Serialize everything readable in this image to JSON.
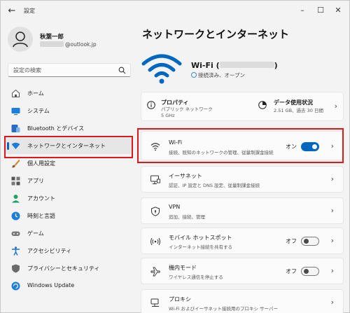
{
  "window": {
    "title": "設定"
  },
  "user": {
    "name": "秋葉一郎",
    "email_suffix": "@outlook.jp"
  },
  "search": {
    "placeholder": "設定の検索"
  },
  "sidebar": {
    "items": [
      {
        "label": "ホーム",
        "icon": "home-icon"
      },
      {
        "label": "システム",
        "icon": "system-icon"
      },
      {
        "label": "Bluetooth とデバイス",
        "icon": "bluetooth-icon"
      },
      {
        "label": "ネットワークとインターネット",
        "icon": "network-icon",
        "active": true
      },
      {
        "label": "個人用設定",
        "icon": "brush-icon"
      },
      {
        "label": "アプリ",
        "icon": "apps-icon"
      },
      {
        "label": "アカウント",
        "icon": "account-icon"
      },
      {
        "label": "時刻と言語",
        "icon": "time-language-icon"
      },
      {
        "label": "ゲーム",
        "icon": "gaming-icon"
      },
      {
        "label": "アクセシビリティ",
        "icon": "accessibility-icon"
      },
      {
        "label": "プライバシーとセキュリティ",
        "icon": "shield-icon"
      },
      {
        "label": "Windows Update",
        "icon": "update-icon"
      }
    ]
  },
  "main": {
    "heading": "ネットワークとインターネット",
    "wifi_header": {
      "name_prefix": "Wi-Fi (",
      "name_suffix": ")",
      "status": "接続済み、オープン"
    },
    "properties": {
      "title": "プロパティ",
      "sub1": "パブリック ネットワーク",
      "sub2": "5 GHz"
    },
    "data_usage": {
      "title": "データ使用状況",
      "sub": "2.51 GB、過去 30 日間"
    },
    "cards": [
      {
        "title": "Wi-Fi",
        "sub": "接続、既知のネットワークの管理、従量制課金接続",
        "state": "オン",
        "toggle": true,
        "icon": "wifi-icon"
      },
      {
        "title": "イーサネット",
        "sub": "認証、IP 設定と DNS 設定、従量制課金接続",
        "icon": "ethernet-icon"
      },
      {
        "title": "VPN",
        "sub": "追加、接続、管理",
        "icon": "vpn-shield-icon"
      },
      {
        "title": "モバイル ホットスポット",
        "sub": "インターネット接続を共有する",
        "state": "オフ",
        "toggle": false,
        "icon": "hotspot-icon"
      },
      {
        "title": "機内モード",
        "sub": "ワイヤレス通信を停止する",
        "state": "オフ",
        "toggle": false,
        "icon": "airplane-icon"
      },
      {
        "title": "プロキシ",
        "sub": "Wi-Fi およびイーサネット接続用のプロキシ サーバー",
        "icon": "proxy-icon"
      }
    ]
  },
  "colors": {
    "accent": "#0067c0",
    "highlight": "#e0161b"
  }
}
